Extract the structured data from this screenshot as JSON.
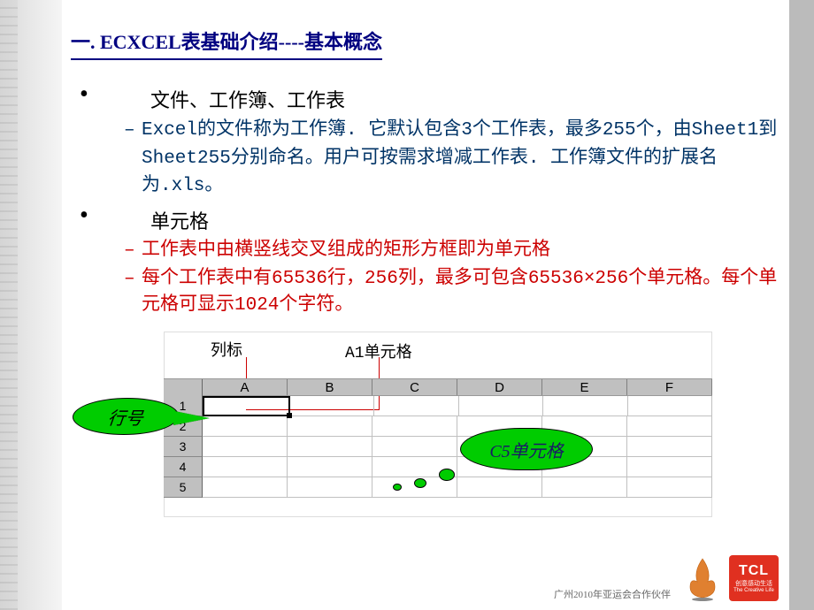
{
  "title": "一. ECXCEL表基础介绍----基本概念",
  "section1": {
    "heading": "文件、工作簿、工作表",
    "body": "Excel的文件称为工作簿. 它默认包含3个工作表，最多255个，由Sheet1到Sheet255分别命名。用户可按需求增减工作表. 工作簿文件的扩展名为.xls。"
  },
  "section2": {
    "heading": "单元格",
    "line1": "工作表中由横竖线交叉组成的矩形方框即为单元格",
    "line2": "每个工作表中有65536行，256列，最多可包含65536×256个单元格。每个单元格可显示1024个字符。"
  },
  "diagram": {
    "col_label": "列标",
    "a1_label": "A1单元格",
    "row_label": "行号",
    "c5_label": "C5单元格",
    "cols": [
      "A",
      "B",
      "C",
      "D",
      "E",
      "F"
    ],
    "rows": [
      "1",
      "2",
      "3",
      "4",
      "5"
    ]
  },
  "footer": {
    "event_text": "广州2010年亚运会合作伙伴",
    "tcl": "TCL",
    "tcl_sub1": "创意感动生活",
    "tcl_sub2": "The Creative Life"
  }
}
